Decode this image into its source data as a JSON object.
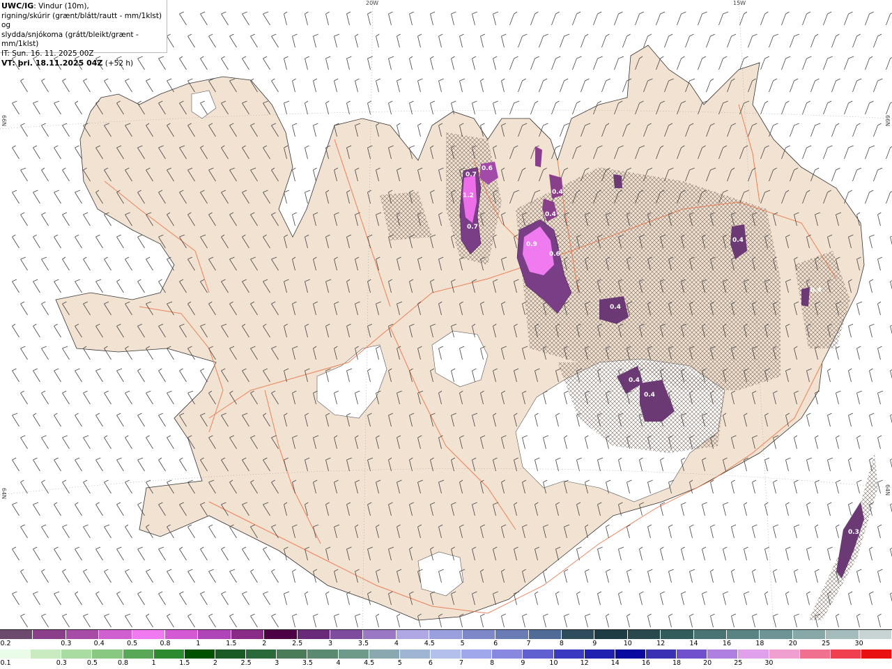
{
  "header": {
    "model": "UWC/IG",
    "line1": ": Vindur (10m),",
    "line2": "rigning/skúrir (grænt/blátt/rautt - mm/1klst) og",
    "line3": "slydda/snjókoma (grátt/bleikt/grænt - mm/1klst)",
    "it": "IT: Sun. 16. 11. 2025 00Z",
    "vt_label": "VT: þri. 18.11.2025 04Z",
    "vt_offset": " (+52 h)"
  },
  "grid_labels": {
    "lon_20w": "20W",
    "lon_15w": "15W",
    "lat_66n_left": "66N",
    "lat_66n_right": "66N",
    "lat_64n_left": "64N",
    "lat_64n_right": "64N"
  },
  "precip_labels": [
    "0.7",
    "0.6",
    "1.2",
    "0.7",
    "0.9",
    "0.6",
    "0.4",
    "0.4",
    "0.4",
    "0.4",
    "0.4",
    "0.4",
    "0.4",
    "0.3"
  ],
  "legend_snow": {
    "colors": [
      "#6b4a6e",
      "#8a3f8a",
      "#a64ca6",
      "#d05fd0",
      "#f07af0",
      "#d45ad4",
      "#b045b8",
      "#882c88",
      "#4d0044",
      "#6a2a7a",
      "#7e4c9e",
      "#9a78c4",
      "#b0a8e4",
      "#9aa0dc",
      "#7e88c8",
      "#6a7cb4",
      "#506c96",
      "#2e4c5c",
      "#1e3c44",
      "#28484e",
      "#325c5c",
      "#4a7474",
      "#5a8484",
      "#6e9496",
      "#88a8a8",
      "#a4bcbc",
      "#c8d4d4"
    ],
    "labels": [
      "0.2",
      "0.3",
      "0.4",
      "0.5",
      "0.8",
      "1",
      "1.5",
      "2",
      "2.5",
      "3",
      "3.5",
      "4",
      "4.5",
      "5",
      "6",
      "7",
      "8",
      "9",
      "10",
      "12",
      "14",
      "16",
      "18",
      "20",
      "25",
      "30"
    ]
  },
  "legend_rain": {
    "colors": [
      "#e8fce8",
      "#c8ecc0",
      "#a8dca0",
      "#88c880",
      "#58a858",
      "#2e8a2e",
      "#005200",
      "#1a5a24",
      "#2a6a3a",
      "#4a7c5a",
      "#5a8a70",
      "#6e9a8a",
      "#8aa8b0",
      "#a0b4d4",
      "#b4c0ec",
      "#a0a8ec",
      "#8888e0",
      "#6060d0",
      "#3a3ac0",
      "#2020b0",
      "#0a0aa0",
      "#3a30b4",
      "#7050cc",
      "#b080e0",
      "#e0a0ec",
      "#f0a0d0",
      "#f07090",
      "#f04050",
      "#e81010"
    ],
    "labels": [
      "0.1",
      "0.3",
      "0.5",
      "0.8",
      "1",
      "1.5",
      "2",
      "2.5",
      "3",
      "3.5",
      "4",
      "4.5",
      "5",
      "6",
      "7",
      "8",
      "9",
      "10",
      "12",
      "14",
      "16",
      "18",
      "20",
      "25",
      "30"
    ]
  }
}
